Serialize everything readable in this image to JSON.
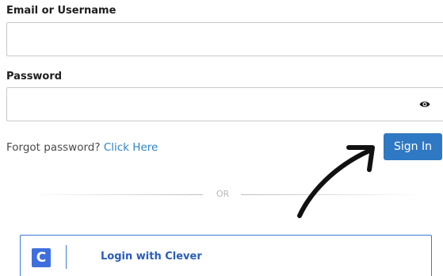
{
  "form": {
    "email_label": "Email or Username",
    "email_value": "",
    "email_placeholder": "",
    "password_label": "Password",
    "password_value": "",
    "password_placeholder": "",
    "forgot_text": "Forgot password?",
    "forgot_link": "Click Here",
    "signin_label": "Sign In"
  },
  "divider": {
    "text": "OR"
  },
  "clever": {
    "logo_letter": "C",
    "label": "Login with Clever"
  },
  "icons": {
    "password_toggle": "eye-icon",
    "annotation": "arrow-icon",
    "clever_logo": "clever-logo-icon"
  },
  "colors": {
    "accent": "#2f78c3",
    "link": "#2f83c6",
    "clever_blue": "#3f6fdc"
  }
}
